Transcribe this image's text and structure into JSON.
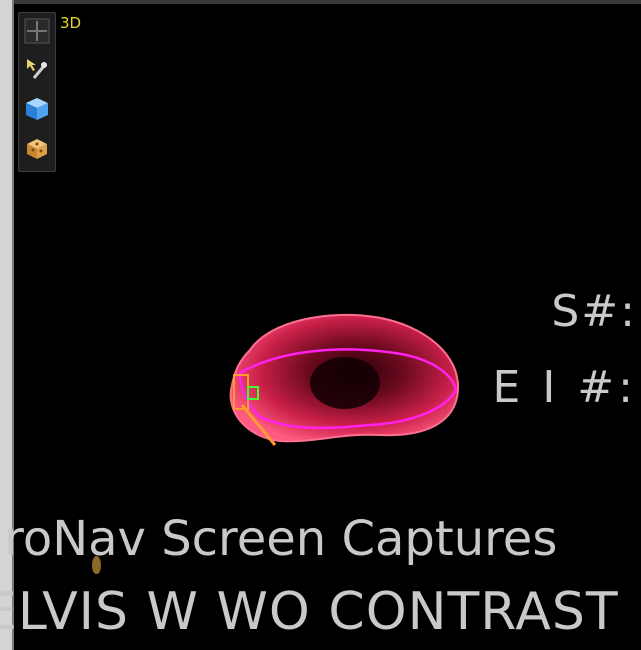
{
  "viewport": {
    "mode_label": "3D",
    "view_type": "3D volume render"
  },
  "toolbar": {
    "tools": [
      {
        "name": "crosshair-icon"
      },
      {
        "name": "probe-pointer-icon"
      },
      {
        "name": "cube-3d-icon"
      },
      {
        "name": "volume-render-icon"
      }
    ]
  },
  "overlay": {
    "series_label": "S#:",
    "image_label": "E I #:",
    "line1": "JroNav Screen Captures",
    "line2": "ELVIS W WO CONTRAST"
  },
  "colors": {
    "organ_fill": "#d8264e",
    "contour": "#ff22ee",
    "marker_green": "#3dff2d",
    "marker_orange": "#ff9a33",
    "mode_label": "#e8d82a",
    "overlay_text": "#c9c9c9"
  }
}
